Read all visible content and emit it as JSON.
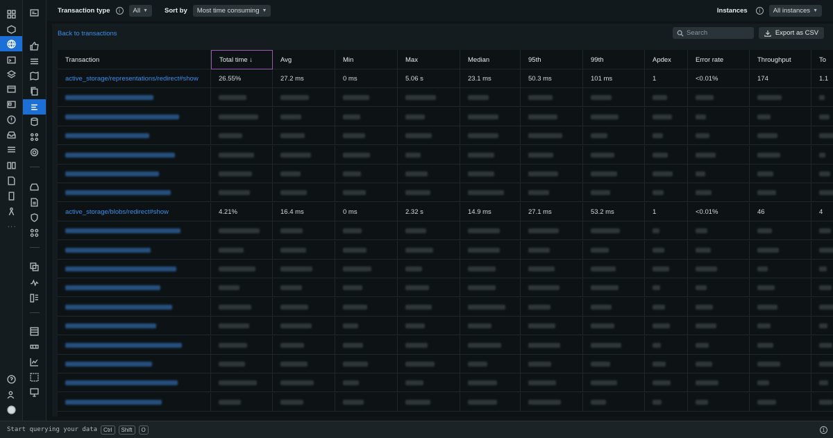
{
  "topbar": {
    "transaction_type_label": "Transaction type",
    "transaction_type_value": "All",
    "sort_by_label": "Sort by",
    "sort_by_value": "Most time consuming",
    "instances_label": "Instances",
    "instances_value": "All instances"
  },
  "toolbar": {
    "back_link": "Back to transactions",
    "search_placeholder": "Search",
    "export_label": "Export as CSV"
  },
  "table": {
    "columns": [
      "Transaction",
      "Total time ↓",
      "Avg",
      "Min",
      "Max",
      "Median",
      "95th",
      "99th",
      "Apdex",
      "Error rate",
      "Throughput",
      "To"
    ],
    "rows": {
      "r0": [
        "active_storage/representations/redirect#show",
        "26.55%",
        "27.2 ms",
        "0 ms",
        "5.06 s",
        "23.1 ms",
        "50.3 ms",
        "101 ms",
        "1",
        "<0.01%",
        "174",
        "1.1"
      ],
      "r7": [
        "active_storage/blobs/redirect#show",
        "4.21%",
        "16.4 ms",
        "0 ms",
        "2.32 s",
        "14.9 ms",
        "27.1 ms",
        "53.2 ms",
        "1",
        "<0.01%",
        "46",
        "4"
      ]
    }
  },
  "bottombar": {
    "prompt": "Start querying your data",
    "key1": "Ctrl",
    "key2": "Shift",
    "key3": "O"
  }
}
